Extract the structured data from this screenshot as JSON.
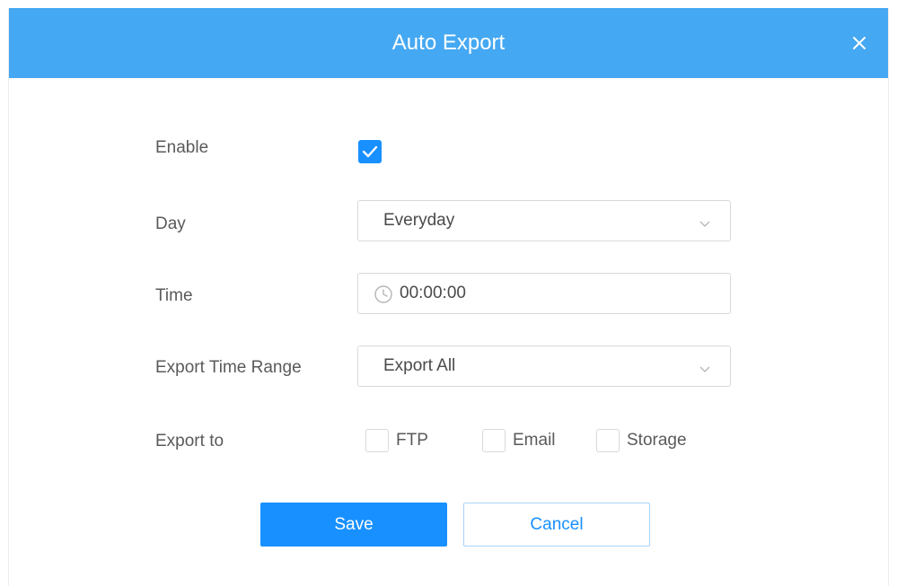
{
  "dialog": {
    "title": "Auto Export",
    "close_icon": "close-icon"
  },
  "form": {
    "enable": {
      "label": "Enable",
      "checked": true
    },
    "day": {
      "label": "Day",
      "value": "Everyday",
      "icon": "chevron-down-icon"
    },
    "time": {
      "label": "Time",
      "value": "00:00:00",
      "icon": "clock-icon"
    },
    "export_time_range": {
      "label": "Export Time Range",
      "value": "Export All",
      "icon": "chevron-down-icon"
    },
    "export_to": {
      "label": "Export to",
      "options": [
        {
          "label": "FTP",
          "checked": false
        },
        {
          "label": "Email",
          "checked": false
        },
        {
          "label": "Storage",
          "checked": false
        }
      ]
    }
  },
  "buttons": {
    "save": "Save",
    "cancel": "Cancel"
  },
  "colors": {
    "header": "#45a8f2",
    "primary": "#1890ff"
  }
}
